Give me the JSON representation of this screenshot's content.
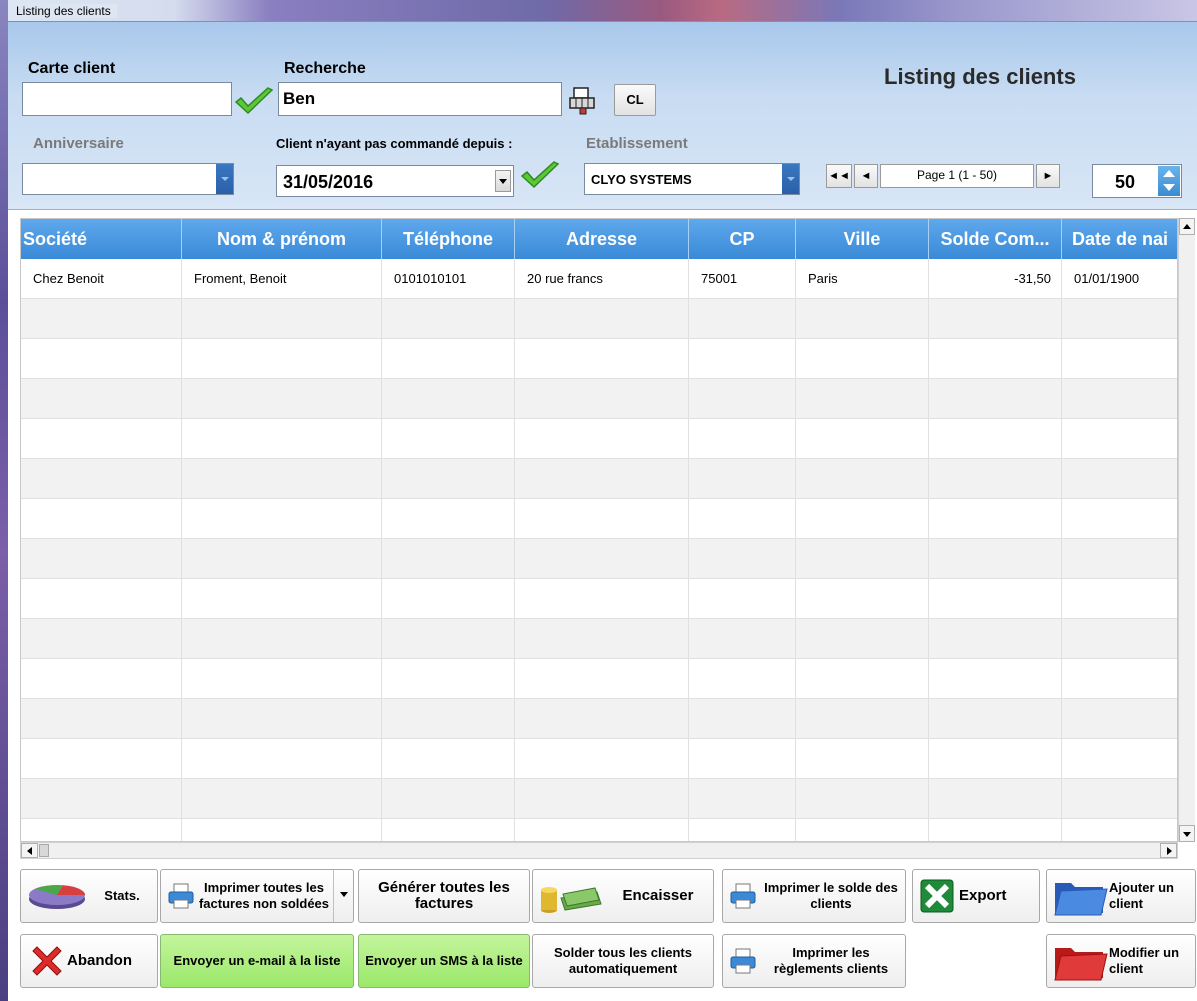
{
  "window": {
    "title": "Listing des clients"
  },
  "header": {
    "carte_label": "Carte client",
    "carte_value": "",
    "recherche_label": "Recherche",
    "recherche_value": "Ben",
    "cl_label": "CL",
    "page_title": "Listing des clients",
    "anniversaire_label": "Anniversaire",
    "anniversaire_value": "",
    "depuis_label": "Client n'ayant pas commandé depuis :",
    "depuis_value": "31/05/2016",
    "etablissement_label": "Etablissement",
    "etablissement_value": "CLYO SYSTEMS",
    "page_info": "Page 1 (1 - 50)",
    "page_size": "50"
  },
  "grid": {
    "columns": [
      "Société",
      "Nom & prénom",
      "Téléphone",
      "Adresse",
      "CP",
      "Ville",
      "Solde Com...",
      "Date de nai"
    ],
    "rows": [
      [
        "Chez Benoit",
        "Froment, Benoit",
        "0101010101",
        "20 rue francs",
        "75001",
        "Paris",
        "-31,50",
        "01/01/1900"
      ]
    ]
  },
  "buttons": {
    "stats": "Stats.",
    "print_unpaid": "Imprimer toutes les factures non soldées",
    "generate_invoices": "Générer toutes les factures",
    "cash_in": "Encaisser",
    "print_balance": "Imprimer le solde des clients",
    "export": "Export",
    "add_client": "Ajouter un client",
    "abandon": "Abandon",
    "send_email": "Envoyer un e-mail à la liste",
    "send_sms": "Envoyer un SMS à la liste",
    "settle_all": "Solder tous les clients automatiquement",
    "print_payments": "Imprimer les règlements clients",
    "edit_client": "Modifier un client"
  }
}
